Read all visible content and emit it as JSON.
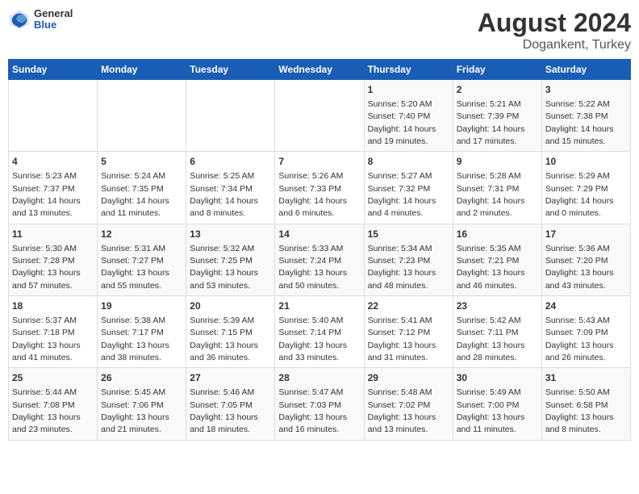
{
  "logo": {
    "general": "General",
    "blue": "Blue"
  },
  "title": "August 2024",
  "subtitle": "Dogankent, Turkey",
  "weekdays": [
    "Sunday",
    "Monday",
    "Tuesday",
    "Wednesday",
    "Thursday",
    "Friday",
    "Saturday"
  ],
  "weeks": [
    [
      {
        "day": "",
        "sunrise": "",
        "sunset": "",
        "daylight": ""
      },
      {
        "day": "",
        "sunrise": "",
        "sunset": "",
        "daylight": ""
      },
      {
        "day": "",
        "sunrise": "",
        "sunset": "",
        "daylight": ""
      },
      {
        "day": "",
        "sunrise": "",
        "sunset": "",
        "daylight": ""
      },
      {
        "day": "1",
        "sunrise": "Sunrise: 5:20 AM",
        "sunset": "Sunset: 7:40 PM",
        "daylight": "Daylight: 14 hours and 19 minutes."
      },
      {
        "day": "2",
        "sunrise": "Sunrise: 5:21 AM",
        "sunset": "Sunset: 7:39 PM",
        "daylight": "Daylight: 14 hours and 17 minutes."
      },
      {
        "day": "3",
        "sunrise": "Sunrise: 5:22 AM",
        "sunset": "Sunset: 7:38 PM",
        "daylight": "Daylight: 14 hours and 15 minutes."
      }
    ],
    [
      {
        "day": "4",
        "sunrise": "Sunrise: 5:23 AM",
        "sunset": "Sunset: 7:37 PM",
        "daylight": "Daylight: 14 hours and 13 minutes."
      },
      {
        "day": "5",
        "sunrise": "Sunrise: 5:24 AM",
        "sunset": "Sunset: 7:35 PM",
        "daylight": "Daylight: 14 hours and 11 minutes."
      },
      {
        "day": "6",
        "sunrise": "Sunrise: 5:25 AM",
        "sunset": "Sunset: 7:34 PM",
        "daylight": "Daylight: 14 hours and 8 minutes."
      },
      {
        "day": "7",
        "sunrise": "Sunrise: 5:26 AM",
        "sunset": "Sunset: 7:33 PM",
        "daylight": "Daylight: 14 hours and 6 minutes."
      },
      {
        "day": "8",
        "sunrise": "Sunrise: 5:27 AM",
        "sunset": "Sunset: 7:32 PM",
        "daylight": "Daylight: 14 hours and 4 minutes."
      },
      {
        "day": "9",
        "sunrise": "Sunrise: 5:28 AM",
        "sunset": "Sunset: 7:31 PM",
        "daylight": "Daylight: 14 hours and 2 minutes."
      },
      {
        "day": "10",
        "sunrise": "Sunrise: 5:29 AM",
        "sunset": "Sunset: 7:29 PM",
        "daylight": "Daylight: 14 hours and 0 minutes."
      }
    ],
    [
      {
        "day": "11",
        "sunrise": "Sunrise: 5:30 AM",
        "sunset": "Sunset: 7:28 PM",
        "daylight": "Daylight: 13 hours and 57 minutes."
      },
      {
        "day": "12",
        "sunrise": "Sunrise: 5:31 AM",
        "sunset": "Sunset: 7:27 PM",
        "daylight": "Daylight: 13 hours and 55 minutes."
      },
      {
        "day": "13",
        "sunrise": "Sunrise: 5:32 AM",
        "sunset": "Sunset: 7:25 PM",
        "daylight": "Daylight: 13 hours and 53 minutes."
      },
      {
        "day": "14",
        "sunrise": "Sunrise: 5:33 AM",
        "sunset": "Sunset: 7:24 PM",
        "daylight": "Daylight: 13 hours and 50 minutes."
      },
      {
        "day": "15",
        "sunrise": "Sunrise: 5:34 AM",
        "sunset": "Sunset: 7:23 PM",
        "daylight": "Daylight: 13 hours and 48 minutes."
      },
      {
        "day": "16",
        "sunrise": "Sunrise: 5:35 AM",
        "sunset": "Sunset: 7:21 PM",
        "daylight": "Daylight: 13 hours and 46 minutes."
      },
      {
        "day": "17",
        "sunrise": "Sunrise: 5:36 AM",
        "sunset": "Sunset: 7:20 PM",
        "daylight": "Daylight: 13 hours and 43 minutes."
      }
    ],
    [
      {
        "day": "18",
        "sunrise": "Sunrise: 5:37 AM",
        "sunset": "Sunset: 7:18 PM",
        "daylight": "Daylight: 13 hours and 41 minutes."
      },
      {
        "day": "19",
        "sunrise": "Sunrise: 5:38 AM",
        "sunset": "Sunset: 7:17 PM",
        "daylight": "Daylight: 13 hours and 38 minutes."
      },
      {
        "day": "20",
        "sunrise": "Sunrise: 5:39 AM",
        "sunset": "Sunset: 7:15 PM",
        "daylight": "Daylight: 13 hours and 36 minutes."
      },
      {
        "day": "21",
        "sunrise": "Sunrise: 5:40 AM",
        "sunset": "Sunset: 7:14 PM",
        "daylight": "Daylight: 13 hours and 33 minutes."
      },
      {
        "day": "22",
        "sunrise": "Sunrise: 5:41 AM",
        "sunset": "Sunset: 7:12 PM",
        "daylight": "Daylight: 13 hours and 31 minutes."
      },
      {
        "day": "23",
        "sunrise": "Sunrise: 5:42 AM",
        "sunset": "Sunset: 7:11 PM",
        "daylight": "Daylight: 13 hours and 28 minutes."
      },
      {
        "day": "24",
        "sunrise": "Sunrise: 5:43 AM",
        "sunset": "Sunset: 7:09 PM",
        "daylight": "Daylight: 13 hours and 26 minutes."
      }
    ],
    [
      {
        "day": "25",
        "sunrise": "Sunrise: 5:44 AM",
        "sunset": "Sunset: 7:08 PM",
        "daylight": "Daylight: 13 hours and 23 minutes."
      },
      {
        "day": "26",
        "sunrise": "Sunrise: 5:45 AM",
        "sunset": "Sunset: 7:06 PM",
        "daylight": "Daylight: 13 hours and 21 minutes."
      },
      {
        "day": "27",
        "sunrise": "Sunrise: 5:46 AM",
        "sunset": "Sunset: 7:05 PM",
        "daylight": "Daylight: 13 hours and 18 minutes."
      },
      {
        "day": "28",
        "sunrise": "Sunrise: 5:47 AM",
        "sunset": "Sunset: 7:03 PM",
        "daylight": "Daylight: 13 hours and 16 minutes."
      },
      {
        "day": "29",
        "sunrise": "Sunrise: 5:48 AM",
        "sunset": "Sunset: 7:02 PM",
        "daylight": "Daylight: 13 hours and 13 minutes."
      },
      {
        "day": "30",
        "sunrise": "Sunrise: 5:49 AM",
        "sunset": "Sunset: 7:00 PM",
        "daylight": "Daylight: 13 hours and 11 minutes."
      },
      {
        "day": "31",
        "sunrise": "Sunrise: 5:50 AM",
        "sunset": "Sunset: 6:58 PM",
        "daylight": "Daylight: 13 hours and 8 minutes."
      }
    ]
  ]
}
